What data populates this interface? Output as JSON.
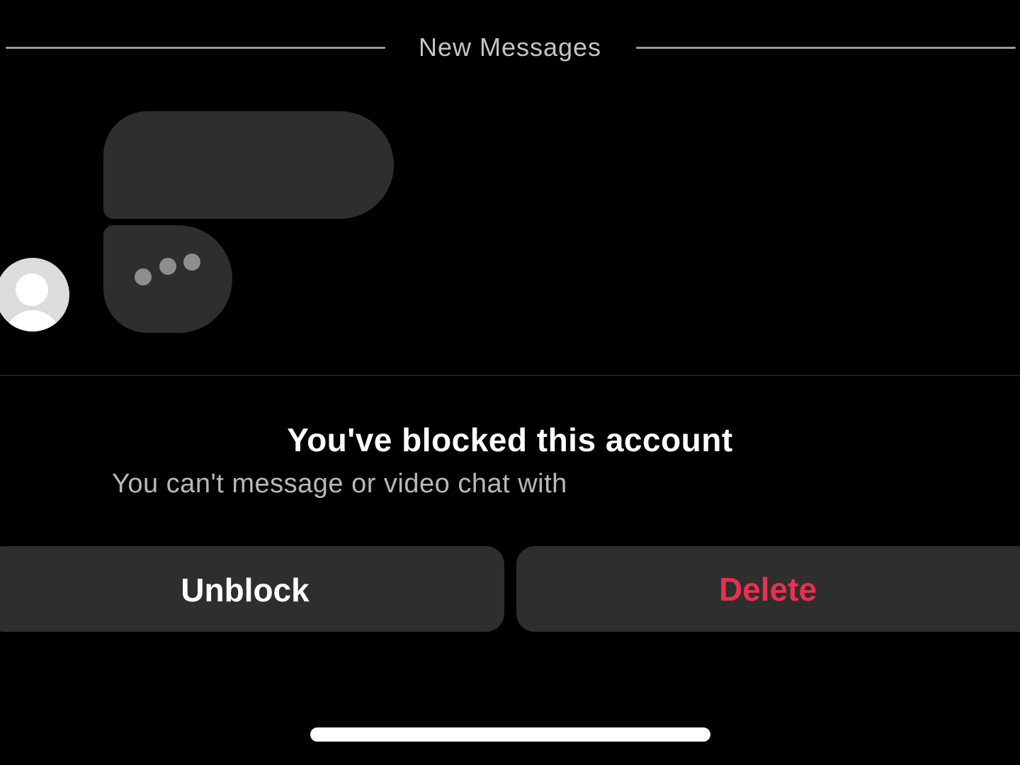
{
  "divider": {
    "label": "New Messages"
  },
  "blocked": {
    "title": "You've blocked this account",
    "subtitle": "You can't message or video chat with"
  },
  "actions": {
    "unblock_label": "Unblock",
    "delete_label": "Delete"
  },
  "icons": {
    "avatar": "default-avatar-icon",
    "typing": "typing-dots-icon"
  },
  "colors": {
    "background": "#000000",
    "bubble": "#2e2e2e",
    "button": "#2e2e2e",
    "delete_text": "#e8304f",
    "primary_text": "#ffffff",
    "secondary_text": "#b8b8b8"
  }
}
